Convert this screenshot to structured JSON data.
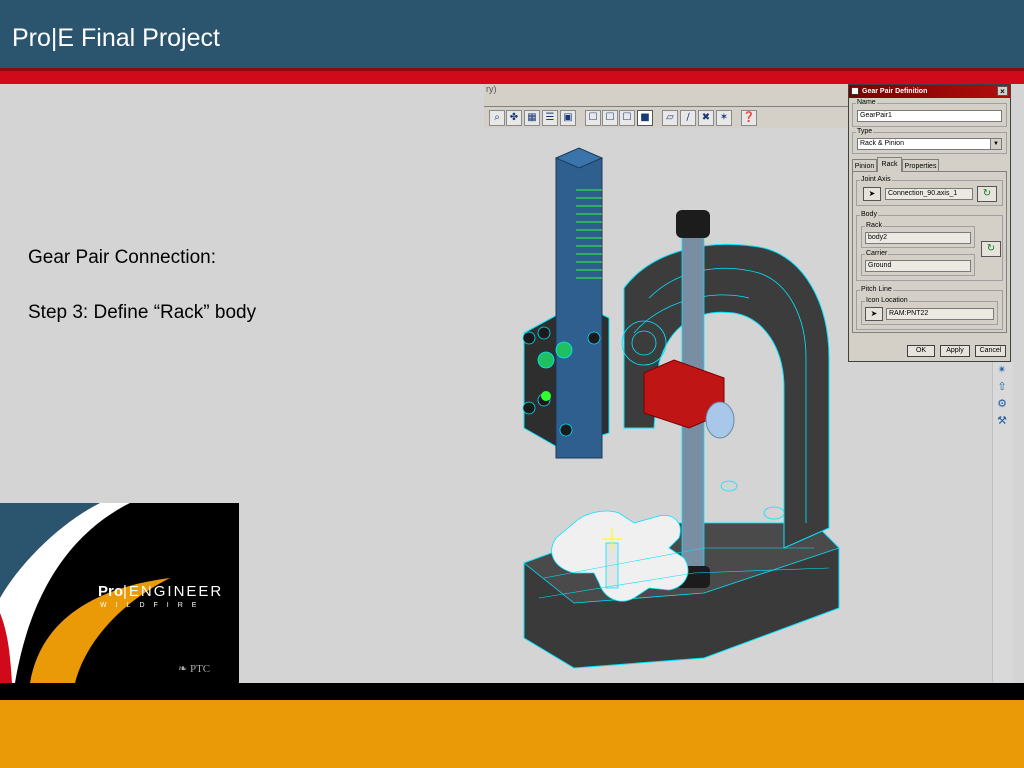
{
  "slide": {
    "title": "Pro|E Final Project",
    "heading": "Gear Pair Connection:",
    "step": "Step 3: Define “Rack” body"
  },
  "logo": {
    "brand_bold": "Pro",
    "brand_rest": "ENGINEER",
    "sub": "WILDFIRE",
    "company": "PTC"
  },
  "toolbar": {
    "title_fragment": "ry)",
    "buttons": [
      "zoom-window",
      "spin-center",
      "datum-plane",
      "layers",
      "named-views",
      "wireframe",
      "hidden-line",
      "no-hidden",
      "shading",
      "datum-axes",
      "datum-points",
      "coordinate-systems",
      "annotations",
      "context-help"
    ]
  },
  "dialog": {
    "title": "Gear Pair Definition",
    "close": "×",
    "name_label": "Name",
    "name_value": "GearPair1",
    "type_label": "Type",
    "type_value": "Rack & Pinion",
    "tabs": [
      "Pinion",
      "Rack",
      "Properties"
    ],
    "active_tab": "Rack",
    "joint_axis_label": "Joint Axis",
    "joint_axis_value": "Connection_90.axis_1",
    "body_label": "Body",
    "rack_label": "Rack",
    "rack_value": "body2",
    "carrier_label": "Carrier",
    "carrier_value": "Ground",
    "pitch_line_label": "Pitch Line",
    "icon_location_label": "Icon Location",
    "icon_location_value": "RAM:PNT22",
    "ok": "OK",
    "apply": "Apply",
    "cancel": "Cancel"
  },
  "colors": {
    "title_bar": "#2b546e",
    "red_bar": "#d10a1b",
    "orange_bar": "#ea9a07",
    "wireframe": "#00e5ff",
    "rack": "#2e5f8e",
    "dialog_title": "#8b0000"
  }
}
